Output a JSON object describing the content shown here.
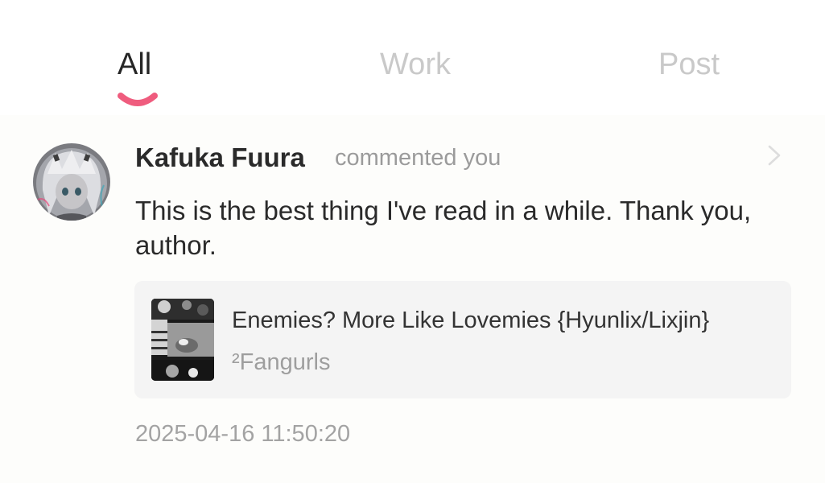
{
  "tabs": [
    {
      "label": "All",
      "active": true
    },
    {
      "label": "Work",
      "active": false
    },
    {
      "label": "Post",
      "active": false
    }
  ],
  "colors": {
    "active_tab_text": "#262626",
    "inactive_tab_text": "#c9c9c9",
    "indicator_accent": "#ef5c7e",
    "card_background": "#f4f4f4",
    "muted_text": "#9e9e9e"
  },
  "notification": {
    "avatar_icon": "anime-girl-avatar",
    "username": "Kafuka Fuura",
    "action": "commented you",
    "comment": "This is the best thing I've read in a while. Thank you, author.",
    "work": {
      "title": "Enemies? More Like Lovemies {Hyunlix/Lixjin}",
      "author": "²Fangurls",
      "cover_icon": "book-cover-image"
    },
    "timestamp": "2025-04-16 11:50:20"
  }
}
